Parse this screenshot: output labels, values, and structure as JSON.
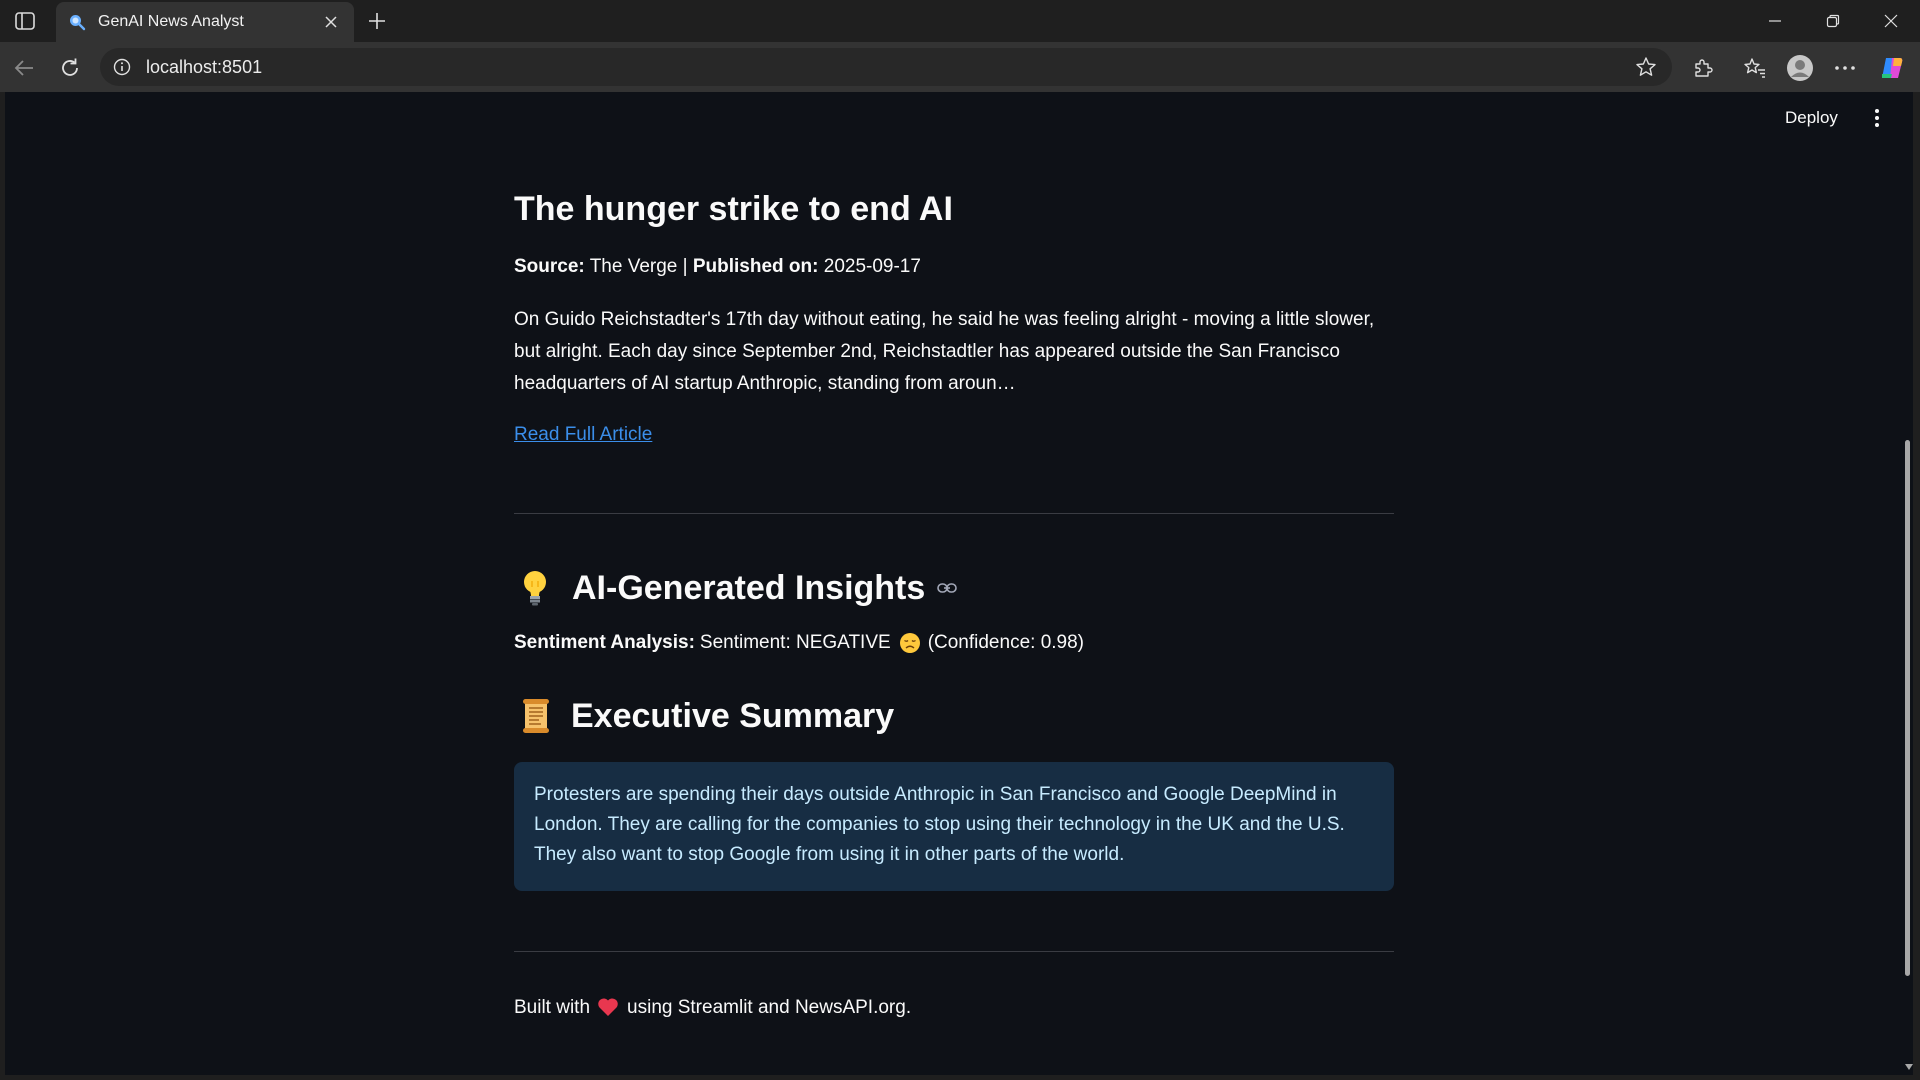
{
  "browser": {
    "tab_title": "GenAI News Analyst",
    "url": "localhost:8501"
  },
  "app_header": {
    "deploy_label": "Deploy"
  },
  "article": {
    "title": "The hunger strike to end AI",
    "source_label": "Source:",
    "source": "The Verge",
    "separator": "|",
    "published_label": "Published on:",
    "published_date": "2025-09-17",
    "description": "On Guido Reichstadter's 17th day without eating, he said he was feeling alright - moving a little slower, but alright. Each day since September 2nd, Reichstadtler has appeared outside the San Francisco headquarters of AI startup Anthropic, standing from aroun…",
    "read_more_label": "Read Full Article"
  },
  "insights": {
    "heading": "AI-Generated Insights",
    "heading_icon": "lightbulb-emoji",
    "sentiment_label": "Sentiment Analysis:",
    "sentiment_text": "Sentiment: NEGATIVE",
    "sentiment_emoji": "disappointed-face-emoji",
    "confidence_text": "(Confidence: 0.98)"
  },
  "summary": {
    "heading": "Executive Summary",
    "heading_icon": "scroll-emoji",
    "text": "Protesters are spending their days outside Anthropic in San Francisco and Google DeepMind in London. They are calling for the companies to stop using their technology in the UK and the U.S. They also want to stop Google from using it in other parts of the world."
  },
  "footer": {
    "prefix": "Built with",
    "icon": "heart-emoji",
    "suffix": "using Streamlit and NewsAPI.org."
  },
  "colors": {
    "app_background": "#0e1117",
    "link": "#3b8eea",
    "info_box_bg": "#172d43",
    "info_box_text": "#c7ebff"
  }
}
